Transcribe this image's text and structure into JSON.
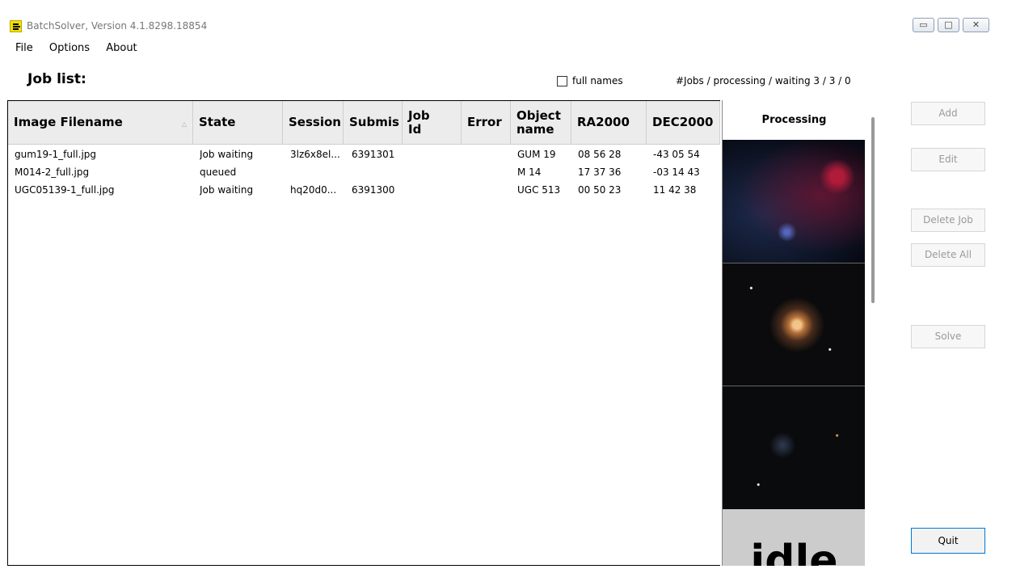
{
  "window": {
    "title": "BatchSolver, Version 4.1.8298.18854",
    "controls": [
      "minimize",
      "maximize",
      "close"
    ]
  },
  "menu": [
    "File",
    "Options",
    "About"
  ],
  "job_list_label": "Job list:",
  "full_names": {
    "label": "full names",
    "checked": false
  },
  "stats": "#Jobs / processing / waiting 3 / 3 / 0",
  "table": {
    "headers": [
      "Image Filename",
      "State",
      "Session",
      "Submis",
      "Job Id",
      "Error",
      "Object name",
      "RA2000",
      "DEC2000"
    ],
    "sort_column": "Image Filename",
    "rows": [
      [
        "gum19-1_full.jpg",
        "Job waiting",
        "3lz6x8el...",
        "6391301",
        "",
        "",
        "GUM 19",
        "08 56 28",
        "-43 05 54"
      ],
      [
        "M014-2_full.jpg",
        "queued",
        "",
        "",
        "",
        "",
        "M 14",
        "17 37 36",
        "-03 14 43"
      ],
      [
        "UGC05139-1_full.jpg",
        "Job waiting",
        "hq20d0...",
        "6391300",
        "",
        "",
        "UGC 513",
        "00 50 23",
        "11 42 38"
      ]
    ]
  },
  "processing": {
    "header": "Processing",
    "thumbnails": [
      "nebula-thumbnail",
      "globular-cluster-thumbnail",
      "dwarf-galaxy-thumbnail"
    ],
    "idle_text": "idle"
  },
  "buttons": {
    "add": "Add",
    "edit": "Edit",
    "delete_job": "Delete Job",
    "delete_all": "Delete All",
    "solve": "Solve",
    "quit": "Quit"
  },
  "colors": {
    "app_icon": "#f4e100",
    "header_bg": "#ececec",
    "disabled_text": "#9a9a9a",
    "focus_border": "#0078d7"
  }
}
